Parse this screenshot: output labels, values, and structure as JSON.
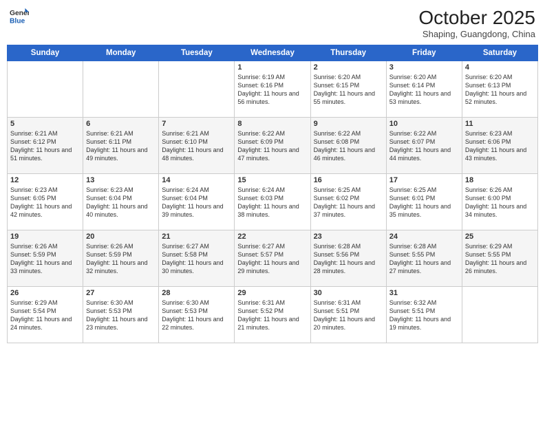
{
  "header": {
    "logo": {
      "general": "General",
      "blue": "Blue"
    },
    "month": "October 2025",
    "location": "Shaping, Guangdong, China"
  },
  "weekdays": [
    "Sunday",
    "Monday",
    "Tuesday",
    "Wednesday",
    "Thursday",
    "Friday",
    "Saturday"
  ],
  "weeks": [
    [
      {
        "day": "",
        "sunrise": "",
        "sunset": "",
        "daylight": ""
      },
      {
        "day": "",
        "sunrise": "",
        "sunset": "",
        "daylight": ""
      },
      {
        "day": "",
        "sunrise": "",
        "sunset": "",
        "daylight": ""
      },
      {
        "day": "1",
        "sunrise": "Sunrise: 6:19 AM",
        "sunset": "Sunset: 6:16 PM",
        "daylight": "Daylight: 11 hours and 56 minutes."
      },
      {
        "day": "2",
        "sunrise": "Sunrise: 6:20 AM",
        "sunset": "Sunset: 6:15 PM",
        "daylight": "Daylight: 11 hours and 55 minutes."
      },
      {
        "day": "3",
        "sunrise": "Sunrise: 6:20 AM",
        "sunset": "Sunset: 6:14 PM",
        "daylight": "Daylight: 11 hours and 53 minutes."
      },
      {
        "day": "4",
        "sunrise": "Sunrise: 6:20 AM",
        "sunset": "Sunset: 6:13 PM",
        "daylight": "Daylight: 11 hours and 52 minutes."
      }
    ],
    [
      {
        "day": "5",
        "sunrise": "Sunrise: 6:21 AM",
        "sunset": "Sunset: 6:12 PM",
        "daylight": "Daylight: 11 hours and 51 minutes."
      },
      {
        "day": "6",
        "sunrise": "Sunrise: 6:21 AM",
        "sunset": "Sunset: 6:11 PM",
        "daylight": "Daylight: 11 hours and 49 minutes."
      },
      {
        "day": "7",
        "sunrise": "Sunrise: 6:21 AM",
        "sunset": "Sunset: 6:10 PM",
        "daylight": "Daylight: 11 hours and 48 minutes."
      },
      {
        "day": "8",
        "sunrise": "Sunrise: 6:22 AM",
        "sunset": "Sunset: 6:09 PM",
        "daylight": "Daylight: 11 hours and 47 minutes."
      },
      {
        "day": "9",
        "sunrise": "Sunrise: 6:22 AM",
        "sunset": "Sunset: 6:08 PM",
        "daylight": "Daylight: 11 hours and 46 minutes."
      },
      {
        "day": "10",
        "sunrise": "Sunrise: 6:22 AM",
        "sunset": "Sunset: 6:07 PM",
        "daylight": "Daylight: 11 hours and 44 minutes."
      },
      {
        "day": "11",
        "sunrise": "Sunrise: 6:23 AM",
        "sunset": "Sunset: 6:06 PM",
        "daylight": "Daylight: 11 hours and 43 minutes."
      }
    ],
    [
      {
        "day": "12",
        "sunrise": "Sunrise: 6:23 AM",
        "sunset": "Sunset: 6:05 PM",
        "daylight": "Daylight: 11 hours and 42 minutes."
      },
      {
        "day": "13",
        "sunrise": "Sunrise: 6:23 AM",
        "sunset": "Sunset: 6:04 PM",
        "daylight": "Daylight: 11 hours and 40 minutes."
      },
      {
        "day": "14",
        "sunrise": "Sunrise: 6:24 AM",
        "sunset": "Sunset: 6:04 PM",
        "daylight": "Daylight: 11 hours and 39 minutes."
      },
      {
        "day": "15",
        "sunrise": "Sunrise: 6:24 AM",
        "sunset": "Sunset: 6:03 PM",
        "daylight": "Daylight: 11 hours and 38 minutes."
      },
      {
        "day": "16",
        "sunrise": "Sunrise: 6:25 AM",
        "sunset": "Sunset: 6:02 PM",
        "daylight": "Daylight: 11 hours and 37 minutes."
      },
      {
        "day": "17",
        "sunrise": "Sunrise: 6:25 AM",
        "sunset": "Sunset: 6:01 PM",
        "daylight": "Daylight: 11 hours and 35 minutes."
      },
      {
        "day": "18",
        "sunrise": "Sunrise: 6:26 AM",
        "sunset": "Sunset: 6:00 PM",
        "daylight": "Daylight: 11 hours and 34 minutes."
      }
    ],
    [
      {
        "day": "19",
        "sunrise": "Sunrise: 6:26 AM",
        "sunset": "Sunset: 5:59 PM",
        "daylight": "Daylight: 11 hours and 33 minutes."
      },
      {
        "day": "20",
        "sunrise": "Sunrise: 6:26 AM",
        "sunset": "Sunset: 5:59 PM",
        "daylight": "Daylight: 11 hours and 32 minutes."
      },
      {
        "day": "21",
        "sunrise": "Sunrise: 6:27 AM",
        "sunset": "Sunset: 5:58 PM",
        "daylight": "Daylight: 11 hours and 30 minutes."
      },
      {
        "day": "22",
        "sunrise": "Sunrise: 6:27 AM",
        "sunset": "Sunset: 5:57 PM",
        "daylight": "Daylight: 11 hours and 29 minutes."
      },
      {
        "day": "23",
        "sunrise": "Sunrise: 6:28 AM",
        "sunset": "Sunset: 5:56 PM",
        "daylight": "Daylight: 11 hours and 28 minutes."
      },
      {
        "day": "24",
        "sunrise": "Sunrise: 6:28 AM",
        "sunset": "Sunset: 5:55 PM",
        "daylight": "Daylight: 11 hours and 27 minutes."
      },
      {
        "day": "25",
        "sunrise": "Sunrise: 6:29 AM",
        "sunset": "Sunset: 5:55 PM",
        "daylight": "Daylight: 11 hours and 26 minutes."
      }
    ],
    [
      {
        "day": "26",
        "sunrise": "Sunrise: 6:29 AM",
        "sunset": "Sunset: 5:54 PM",
        "daylight": "Daylight: 11 hours and 24 minutes."
      },
      {
        "day": "27",
        "sunrise": "Sunrise: 6:30 AM",
        "sunset": "Sunset: 5:53 PM",
        "daylight": "Daylight: 11 hours and 23 minutes."
      },
      {
        "day": "28",
        "sunrise": "Sunrise: 6:30 AM",
        "sunset": "Sunset: 5:53 PM",
        "daylight": "Daylight: 11 hours and 22 minutes."
      },
      {
        "day": "29",
        "sunrise": "Sunrise: 6:31 AM",
        "sunset": "Sunset: 5:52 PM",
        "daylight": "Daylight: 11 hours and 21 minutes."
      },
      {
        "day": "30",
        "sunrise": "Sunrise: 6:31 AM",
        "sunset": "Sunset: 5:51 PM",
        "daylight": "Daylight: 11 hours and 20 minutes."
      },
      {
        "day": "31",
        "sunrise": "Sunrise: 6:32 AM",
        "sunset": "Sunset: 5:51 PM",
        "daylight": "Daylight: 11 hours and 19 minutes."
      },
      {
        "day": "",
        "sunrise": "",
        "sunset": "",
        "daylight": ""
      }
    ]
  ]
}
